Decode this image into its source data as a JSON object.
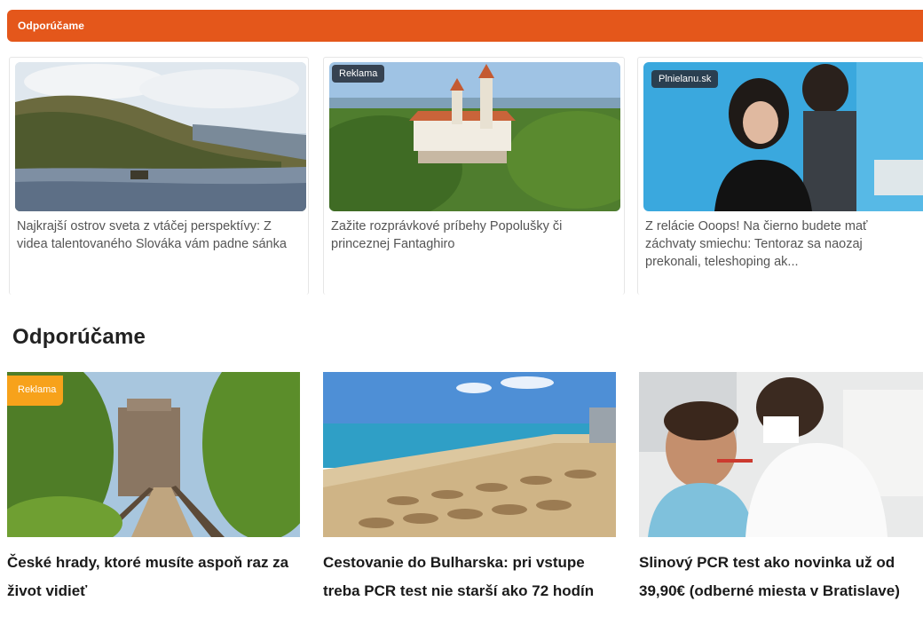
{
  "top_bar": {
    "label": "Odporúčame"
  },
  "sponsored_cards": [
    {
      "badge": "",
      "caption": "Najkrajší ostrov sveta z vtáčej perspektívy: Z videa talentovaného Slováka vám padne sánka"
    },
    {
      "badge": "Reklama",
      "caption": "Zažite rozprávkové príbehy Popolušky či princeznej Fantaghiro"
    },
    {
      "badge": "Plnielanu.sk",
      "caption": "Z relácie Ooops! Na čierno budete mať záchvaty smiechu: Tentoraz sa naozaj prekonali, teleshoping ak..."
    }
  ],
  "section": {
    "title": "Odporúčame"
  },
  "recommended": [
    {
      "badge": "Reklama",
      "headline": "České hrady, ktoré musíte aspoň raz za život vidieť"
    },
    {
      "badge": "",
      "headline": "Cestovanie do Bulharska: pri vstupe treba PCR test nie starší ako 72 hodín"
    },
    {
      "badge": "",
      "headline": "Slinový PCR test ako novinka už od 39,90€ (odberné miesta v Bratislave)"
    }
  ],
  "colors": {
    "top_bar": "#e4571b",
    "badge_orange": "#f7a21b",
    "badge_dark": "#28303c"
  }
}
